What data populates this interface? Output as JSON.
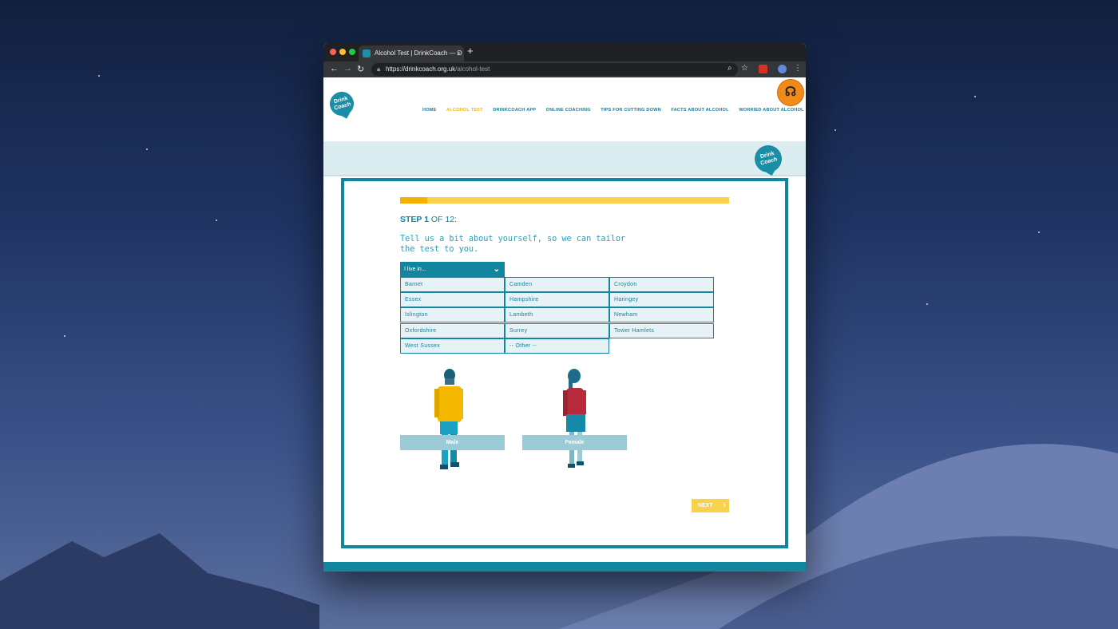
{
  "browser": {
    "tab_title": "Alcohol Test | DrinkCoach — D",
    "tab_close": "×",
    "new_tab": "+",
    "url_host": "https://drinkcoach.org.uk",
    "url_path": "/alcohol-test"
  },
  "site": {
    "logo_text": "Drink Coach",
    "nav": [
      "HOME",
      "ALCOHOL TEST",
      "DRINKCOACH APP",
      "ONLINE COACHING",
      "TIPS FOR CUTTING DOWN",
      "FACTS ABOUT ALCOHOL",
      "WORRIED ABOUT ALCOHOL"
    ],
    "nav_active_index": 1,
    "help_icon": "headset-icon"
  },
  "quiz": {
    "progress_fraction": 0.083,
    "step_label": "STEP 1",
    "step_of": " OF 12:",
    "intro": "Tell us a bit about yourself, so we can tailor the test to you.",
    "dropdown_label": "I live in...",
    "regions": [
      "Barnet",
      "Camden",
      "Croydon",
      "Essex",
      "Hampshire",
      "Haringey",
      "Islington",
      "Lambeth",
      "Newham",
      "Oxfordshire",
      "Surrey",
      "Tower Hamlets",
      "West Sussex",
      "-- Other --"
    ],
    "male_label": "Male",
    "female_label": "Female",
    "next_label": "NEXT"
  },
  "colors": {
    "brand": "#13869f",
    "accent": "#f5b000",
    "button_light": "#9ccbd8"
  }
}
